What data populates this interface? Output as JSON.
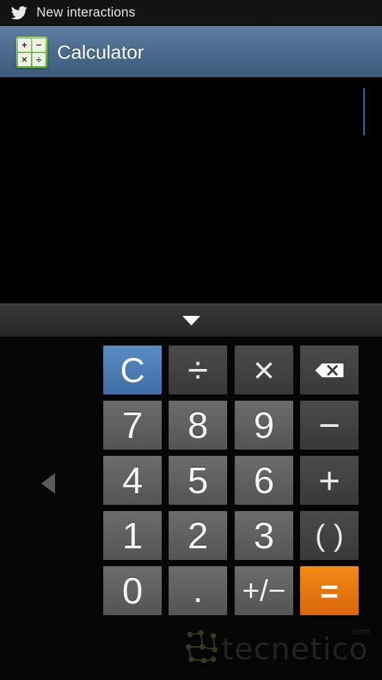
{
  "status_bar": {
    "icon": "twitter-bird-icon",
    "notification_text": "New interactions"
  },
  "title_bar": {
    "app_icon": "calculator-app-icon",
    "app_icon_symbols": [
      "+",
      "−",
      "×",
      "÷"
    ],
    "title": "Calculator"
  },
  "display": {
    "value": "",
    "cursor_color": "#2a78c8"
  },
  "collapse_bar": {
    "icon": "chevron-down-icon"
  },
  "keypad": {
    "side_panel_icon": "triangle-left-icon",
    "keys": {
      "clear": "C",
      "divide": "÷",
      "multiply": "×",
      "backspace_icon": "backspace-icon",
      "seven": "7",
      "eight": "8",
      "nine": "9",
      "minus": "−",
      "four": "4",
      "five": "5",
      "six": "6",
      "plus": "+",
      "one": "1",
      "two": "2",
      "three": "3",
      "parentheses": "( )",
      "zero": "0",
      "decimal": ".",
      "plus_minus": "+/−",
      "equals": "="
    },
    "colors": {
      "clear": "#4a7db6",
      "equals": "#e47a0f",
      "number": "#5f5f5f",
      "operator": "#424242"
    }
  },
  "watermark": {
    "text": "tecnetico",
    "suffix": ".com"
  }
}
